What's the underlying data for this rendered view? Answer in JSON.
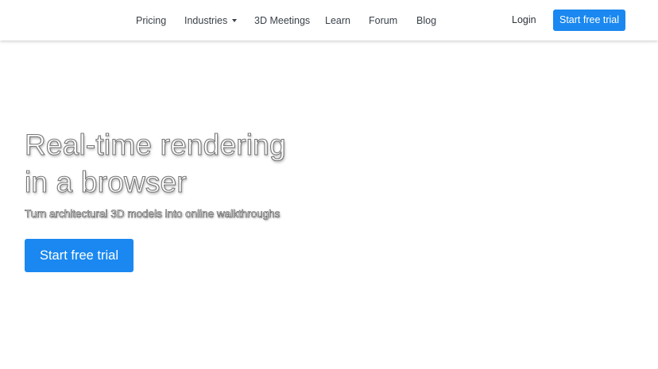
{
  "nav": {
    "items": [
      {
        "label": "Pricing"
      },
      {
        "label": "Industries"
      },
      {
        "label": "3D Meetings"
      },
      {
        "label": "Learn"
      },
      {
        "label": "Forum"
      },
      {
        "label": "Blog"
      }
    ],
    "login_label": "Login",
    "trial_label": "Start free trial"
  },
  "hero": {
    "title_line1": "Real-time rendering",
    "title_line2": "in a browser",
    "subtitle": "Turn architectural 3D models into online walkthroughs",
    "cta_label": "Start free trial"
  },
  "colors": {
    "accent": "#1a88f0",
    "nav_text": "#3a4149"
  },
  "icons": {
    "industries_dropdown": "caret-down-icon"
  }
}
